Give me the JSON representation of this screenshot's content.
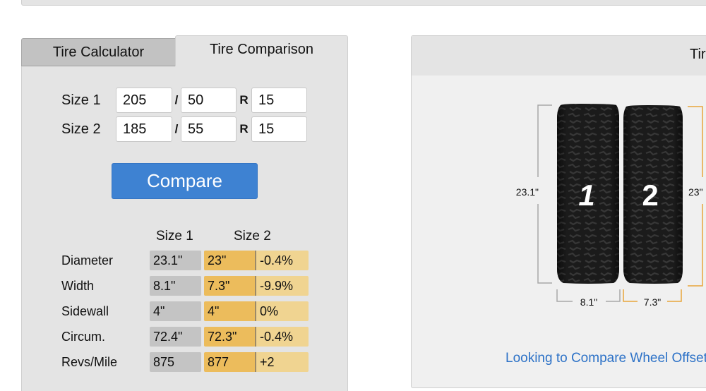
{
  "tabs": [
    {
      "label": "Tire Calculator",
      "active": false
    },
    {
      "label": "Tire Comparison",
      "active": true
    }
  ],
  "form": {
    "sizes": [
      {
        "label": "Size 1",
        "width": "205",
        "aspect": "50",
        "rim": "15"
      },
      {
        "label": "Size 2",
        "width": "185",
        "aspect": "55",
        "rim": "15"
      }
    ],
    "slash": "/",
    "r_label": "R",
    "compare_label": "Compare"
  },
  "results": {
    "headers": [
      "Size 1",
      "Size 2"
    ],
    "rows": [
      {
        "label": "Diameter",
        "size1": "23.1\"",
        "size2": "23\"",
        "diff": "-0.4%"
      },
      {
        "label": "Width",
        "size1": "8.1\"",
        "size2": "7.3\"",
        "diff": "-9.9%"
      },
      {
        "label": "Sidewall",
        "size1": "4\"",
        "size2": "4\"",
        "diff": "0%"
      },
      {
        "label": "Circum.",
        "size1": "72.4\"",
        "size2": "72.3\"",
        "diff": "-0.4%"
      },
      {
        "label": "Revs/Mile",
        "size1": "875",
        "size2": "877",
        "diff": "+2"
      }
    ]
  },
  "visual": {
    "title": "Tire Size Comparison",
    "tire1": {
      "number": "1",
      "diameter": "23.1\"",
      "width": "8.1\""
    },
    "tire2": {
      "number": "2",
      "diameter": "23\"",
      "width": "7.3\""
    },
    "colors": {
      "size1": "#a8a8a8",
      "size2": "#e8a53a"
    },
    "link_text": "Looking to Compare Wheel Offset?"
  },
  "colors": {
    "compare_button": "#3e82d2",
    "size1_cell": "#c4c4c4",
    "size2_cell": "#ecbc5c",
    "diff_cell": "#f0d491",
    "link": "#2d72c7"
  }
}
